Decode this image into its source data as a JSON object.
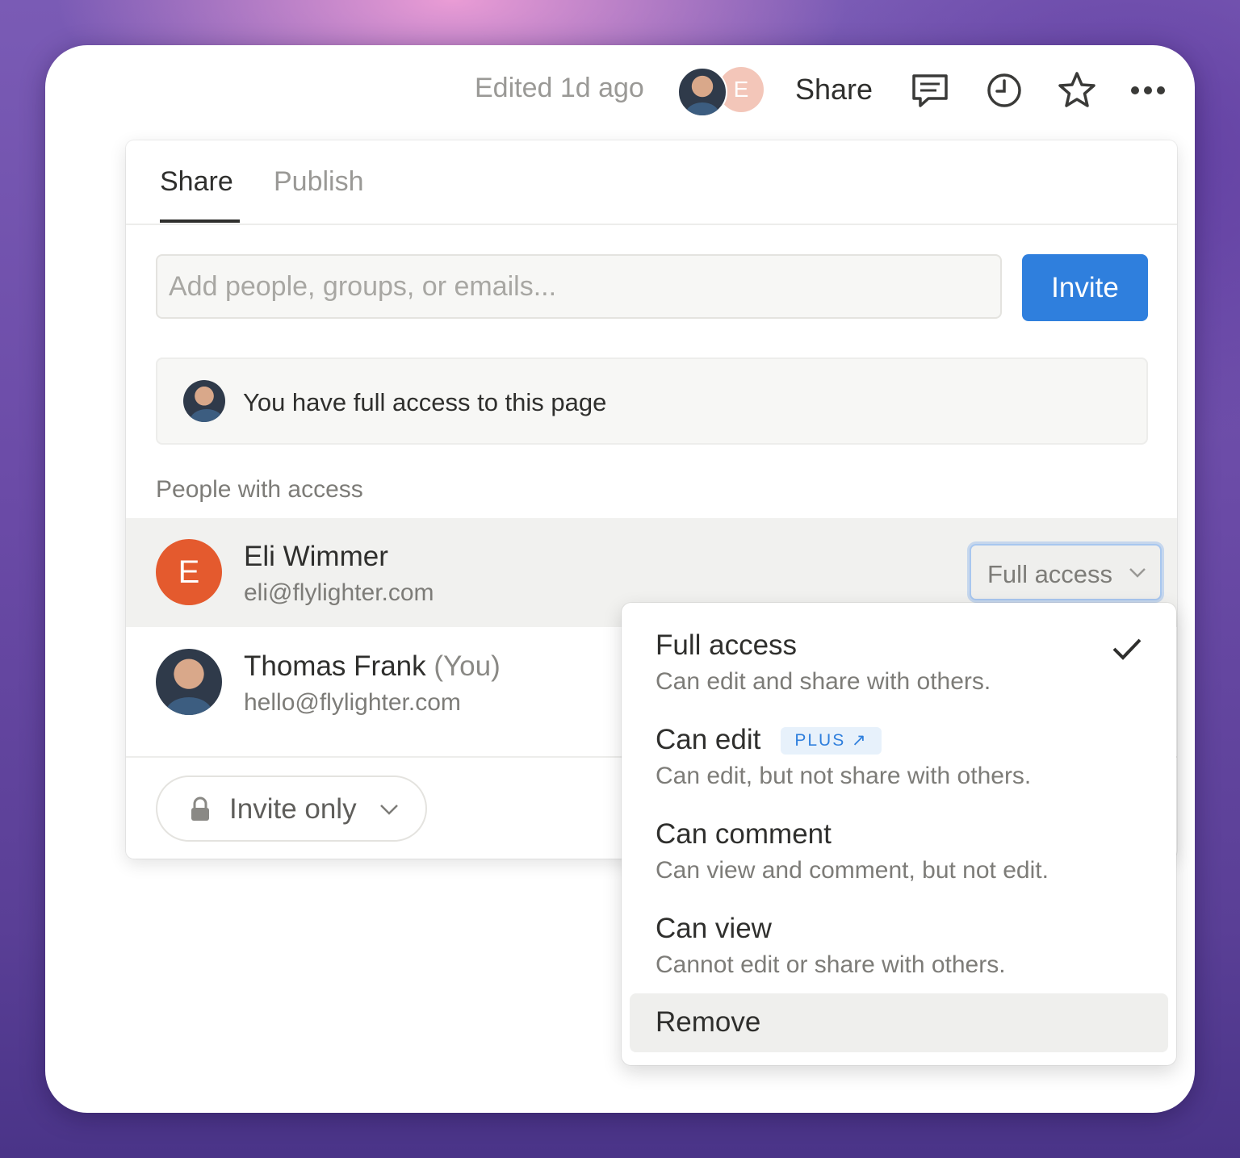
{
  "topbar": {
    "edited": "Edited 1d ago",
    "avatar_letter": "E",
    "share": "Share",
    "icons": [
      "comment-icon",
      "history-clock-icon",
      "star-icon",
      "more-icon"
    ]
  },
  "panel": {
    "tabs": [
      {
        "label": "Share",
        "active": true
      },
      {
        "label": "Publish",
        "active": false
      }
    ],
    "search_placeholder": "Add people, groups, or emails...",
    "invite_button": "Invite",
    "access_notice": "You have full access to this page",
    "people_label": "People with access",
    "people": [
      {
        "initial": "E",
        "name": "Eli Wimmer",
        "suffix": "",
        "email": "eli@flylighter.com",
        "role": "Full access"
      },
      {
        "initial": "",
        "name": "Thomas Frank",
        "suffix": "(You)",
        "email": "hello@flylighter.com",
        "role": ""
      }
    ],
    "general_access": "Invite only"
  },
  "role_menu": {
    "options": [
      {
        "title": "Full access",
        "desc": "Can edit and share with others.",
        "selected": true
      },
      {
        "title": "Can edit",
        "badge": "PLUS ↗",
        "desc": "Can edit, but not share with others."
      },
      {
        "title": "Can comment",
        "desc": "Can view and comment, but not edit."
      },
      {
        "title": "Can view",
        "desc": "Cannot edit or share with others."
      }
    ],
    "remove": "Remove"
  },
  "colors": {
    "accent": "#2f7fdd",
    "avatar_e": "#e45a2e",
    "text": "#2f2f2d",
    "muted": "#7d7c78"
  }
}
